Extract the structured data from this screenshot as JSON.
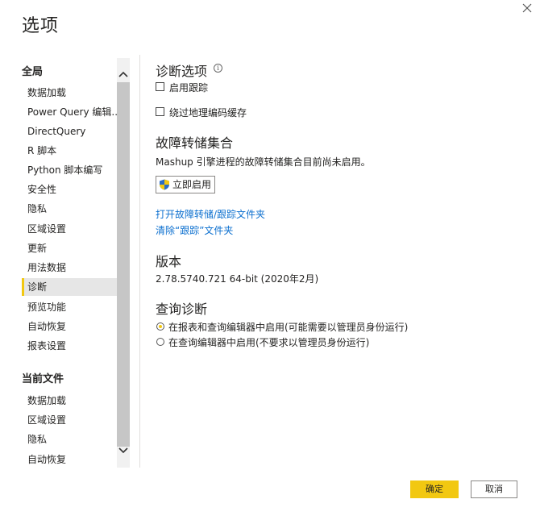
{
  "dialog": {
    "title": "选项",
    "ok_label": "确定",
    "cancel_label": "取消"
  },
  "sidebar": {
    "global_header": "全局",
    "global_items": [
      {
        "label": "数据加载"
      },
      {
        "label": "Power Query 编辑..."
      },
      {
        "label": "DirectQuery"
      },
      {
        "label": "R 脚本"
      },
      {
        "label": "Python 脚本编写"
      },
      {
        "label": "安全性"
      },
      {
        "label": "隐私"
      },
      {
        "label": "区域设置"
      },
      {
        "label": "更新"
      },
      {
        "label": "用法数据"
      },
      {
        "label": "诊断"
      },
      {
        "label": "预览功能"
      },
      {
        "label": "自动恢复"
      },
      {
        "label": "报表设置"
      }
    ],
    "selected": "诊断",
    "file_header": "当前文件",
    "file_items": [
      {
        "label": "数据加载"
      },
      {
        "label": "区域设置"
      },
      {
        "label": "隐私"
      },
      {
        "label": "自动恢复"
      }
    ]
  },
  "diagnostics": {
    "title": "诊断选项",
    "enable_tracing": {
      "label": "启用跟踪",
      "checked": false
    },
    "bypass_geocoding": {
      "label": "绕过地理编码缓存",
      "checked": false
    }
  },
  "crash_dump": {
    "title": "故障转储集合",
    "description": "Mashup 引擎进程的故障转储集合目前尚未启用。",
    "enable_button": "立即启用",
    "open_folder_link": "打开故障转储/跟踪文件夹",
    "clear_traces_link": "清除“跟踪”文件夹"
  },
  "version": {
    "title": "版本",
    "value": "2.78.5740.721 64-bit (2020年2月)"
  },
  "query_diagnostics": {
    "title": "查询诊断",
    "options": [
      {
        "label": "在报表和查询编辑器中启用(可能需要以管理员身份运行)",
        "selected": true
      },
      {
        "label": "在查询编辑器中启用(不要求以管理员身份运行)",
        "selected": false
      }
    ]
  },
  "colors": {
    "accent": "#f2c811",
    "link": "#0b6fcf",
    "selected_bg": "#e6e6e6"
  }
}
